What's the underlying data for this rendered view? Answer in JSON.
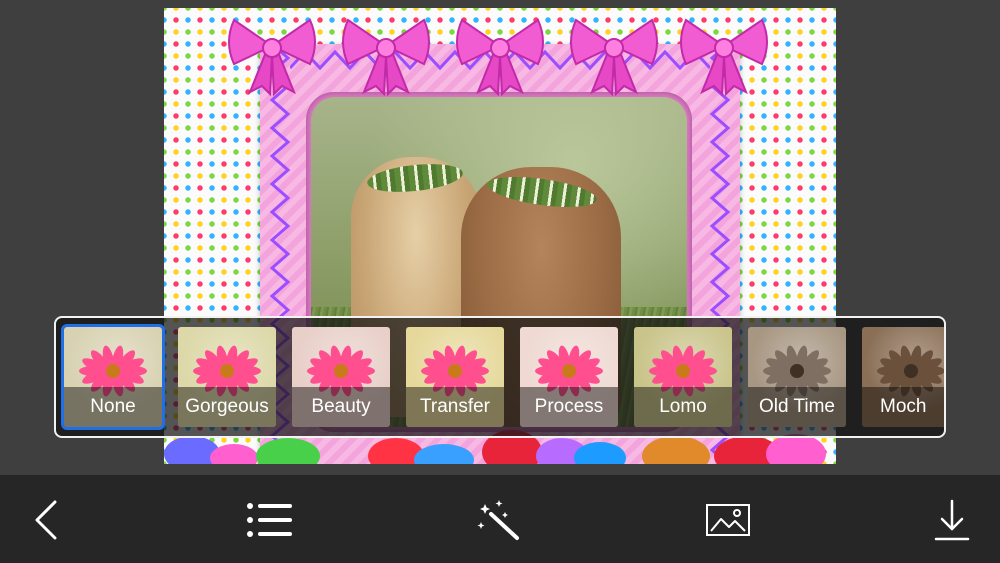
{
  "filters": [
    {
      "label": "None",
      "selected": true,
      "tone": "#d8d2b2"
    },
    {
      "label": "Gorgeous",
      "selected": false,
      "tone": "#dcd8a8"
    },
    {
      "label": "Beauty",
      "selected": false,
      "tone": "#e8cfc8"
    },
    {
      "label": "Transfer",
      "selected": false,
      "tone": "#e6d89a"
    },
    {
      "label": "Process",
      "selected": false,
      "tone": "#efd9d2"
    },
    {
      "label": "Lomo",
      "selected": false,
      "tone": "#c9c48a"
    },
    {
      "label": "Old Time",
      "selected": false,
      "tone": "#a79682"
    },
    {
      "label": "Moch",
      "selected": false,
      "tone": "#8a6f56"
    }
  ],
  "toolbar": {
    "icons": [
      "back-chevron-icon",
      "list-icon",
      "magic-wand-icon",
      "image-icon",
      "download-icon"
    ]
  },
  "colors": {
    "selection": "#1f6fe8",
    "frame_pink": "#f4a4dc",
    "zigzag_purple": "#9b4dff",
    "toolbar_bg": "#262626",
    "page_bg": "#3f3f3f"
  }
}
